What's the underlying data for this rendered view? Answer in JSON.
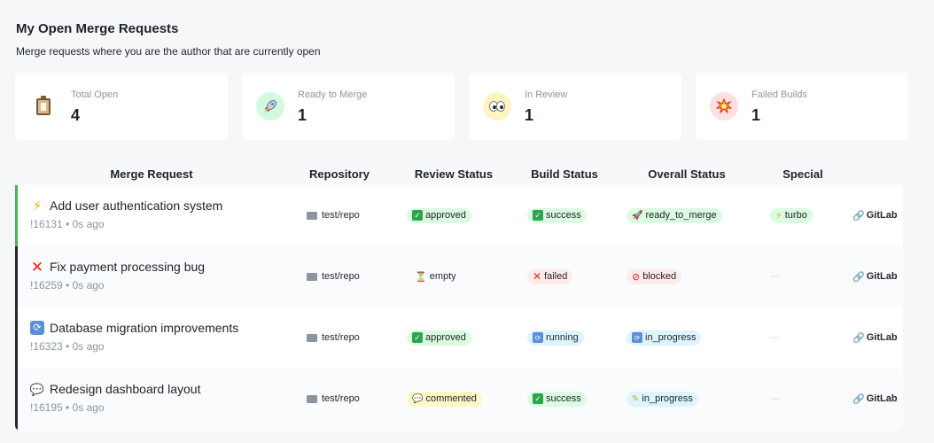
{
  "header": {
    "title": "My Open Merge Requests",
    "subtitle": "Merge requests where you are the author that are currently open"
  },
  "summary": [
    {
      "label": "Total Open",
      "value": "4",
      "icon": "clipboard-icon",
      "bg": "#ffffff"
    },
    {
      "label": "Ready to Merge",
      "value": "1",
      "icon": "rocket-icon",
      "bg": "#d1fadf"
    },
    {
      "label": "In Review",
      "value": "1",
      "icon": "eyes-icon",
      "bg": "#fff4c2"
    },
    {
      "label": "Failed Builds",
      "value": "1",
      "icon": "collision-icon",
      "bg": "#ffe0e0"
    }
  ],
  "table": {
    "columns": [
      "Merge Request",
      "Repository",
      "Review Status",
      "Build Status",
      "Overall Status",
      "Special"
    ],
    "rows": [
      {
        "icon": "⚡",
        "title": "Add user authentication system",
        "meta": "!16131 • 0s ago",
        "repo": "test/repo",
        "review": "approved",
        "build": "success",
        "overall": "ready_to_merge",
        "special": "turbo",
        "link": "GitLab"
      },
      {
        "icon": "✕",
        "title": "Fix payment processing bug",
        "meta": "!16259 • 0s ago",
        "repo": "test/repo",
        "review": "empty",
        "build": "failed",
        "overall": "blocked",
        "special": "—",
        "link": "GitLab"
      },
      {
        "icon": "⟳",
        "title": "Database migration improvements",
        "meta": "!16323 • 0s ago",
        "repo": "test/repo",
        "review": "approved",
        "build": "running",
        "overall": "in_progress",
        "special": "—",
        "link": "GitLab"
      },
      {
        "icon": "💬",
        "title": "Redesign dashboard layout",
        "meta": "!16195 • 0s ago",
        "repo": "test/repo",
        "review": "commented",
        "build": "success",
        "overall": "in_progress",
        "special": "—",
        "link": "GitLab"
      }
    ]
  },
  "colors": {
    "approved": "#dafbe1",
    "failed": "#ffebe9",
    "running": "#ddf4ff",
    "commented": "#fff8c5",
    "accent_ready": "#3fb950",
    "accent_default": "#24292f"
  }
}
